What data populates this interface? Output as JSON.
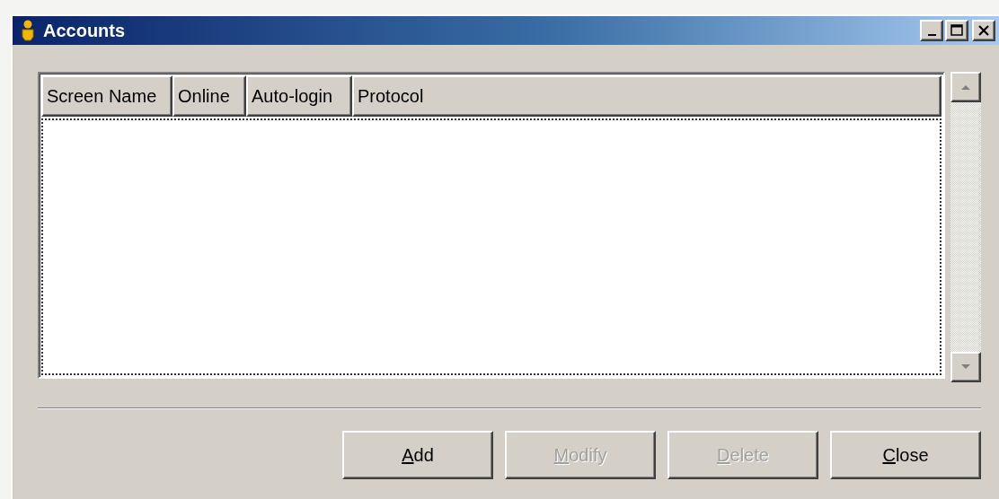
{
  "window": {
    "title": "Accounts"
  },
  "table": {
    "columns": [
      {
        "label": "Screen Name"
      },
      {
        "label": "Online"
      },
      {
        "label": "Auto-login"
      },
      {
        "label": "Protocol"
      }
    ]
  },
  "buttons": [
    {
      "label": "Add",
      "disabled": false
    },
    {
      "label": "Modify",
      "disabled": true
    },
    {
      "label": "Delete",
      "disabled": true
    },
    {
      "label": "Close",
      "disabled": false
    }
  ]
}
